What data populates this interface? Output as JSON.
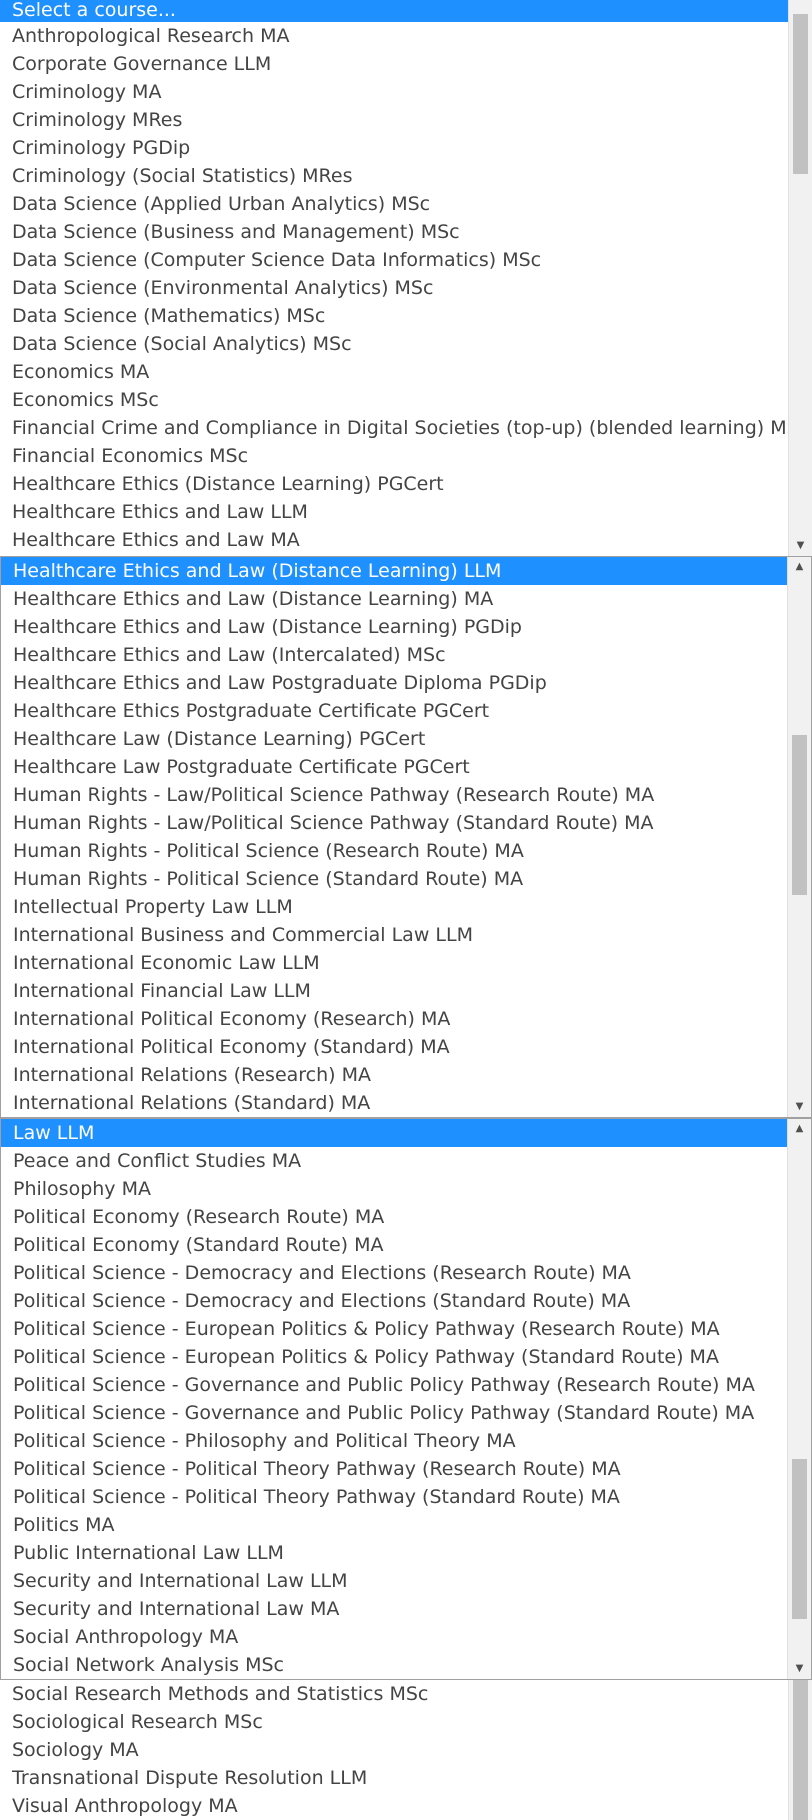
{
  "panel1": {
    "items": [
      {
        "label": "Select a course...",
        "selected": true
      },
      {
        "label": "Anthropological Research MA"
      },
      {
        "label": "Corporate Governance LLM"
      },
      {
        "label": "Criminology MA"
      },
      {
        "label": "Criminology MRes"
      },
      {
        "label": "Criminology PGDip"
      },
      {
        "label": "Criminology (Social Statistics) MRes"
      },
      {
        "label": "Data Science (Applied Urban Analytics) MSc"
      },
      {
        "label": "Data Science (Business and Management) MSc"
      },
      {
        "label": "Data Science (Computer Science Data Informatics) MSc"
      },
      {
        "label": "Data Science (Environmental Analytics) MSc"
      },
      {
        "label": "Data Science (Mathematics) MSc"
      },
      {
        "label": "Data Science (Social Analytics) MSc"
      },
      {
        "label": "Economics MA"
      },
      {
        "label": "Economics MSc"
      },
      {
        "label": "Financial Crime and Compliance in Digital Societies (top-up) (blended learning) MSc"
      },
      {
        "label": "Financial Economics MSc"
      },
      {
        "label": "Healthcare Ethics (Distance Learning) PGCert"
      },
      {
        "label": "Healthcare Ethics and Law LLM"
      },
      {
        "label": "Healthcare Ethics and Law MA"
      }
    ]
  },
  "panel2": {
    "items": [
      {
        "label": "Healthcare Ethics and Law (Distance Learning) LLM",
        "selected": true
      },
      {
        "label": "Healthcare Ethics and Law (Distance Learning) MA"
      },
      {
        "label": "Healthcare Ethics and Law (Distance Learning) PGDip"
      },
      {
        "label": "Healthcare Ethics and Law (Intercalated) MSc"
      },
      {
        "label": "Healthcare Ethics and Law Postgraduate Diploma PGDip"
      },
      {
        "label": "Healthcare Ethics Postgraduate Certificate PGCert"
      },
      {
        "label": "Healthcare Law (Distance Learning) PGCert"
      },
      {
        "label": "Healthcare Law Postgraduate Certificate PGCert"
      },
      {
        "label": "Human Rights - Law/Political Science Pathway (Research Route) MA"
      },
      {
        "label": "Human Rights - Law/Political Science Pathway (Standard Route) MA"
      },
      {
        "label": "Human Rights - Political Science (Research Route) MA"
      },
      {
        "label": "Human Rights - Political Science (Standard Route) MA"
      },
      {
        "label": "Intellectual Property Law LLM"
      },
      {
        "label": "International Business and Commercial Law LLM"
      },
      {
        "label": "International Economic Law LLM"
      },
      {
        "label": "International Financial Law LLM"
      },
      {
        "label": "International Political Economy (Research) MA"
      },
      {
        "label": "International Political Economy (Standard) MA"
      },
      {
        "label": "International Relations (Research) MA"
      },
      {
        "label": "International Relations (Standard) MA"
      }
    ]
  },
  "panel3": {
    "items": [
      {
        "label": "Law LLM",
        "selected": true
      },
      {
        "label": "Peace and Conflict Studies MA"
      },
      {
        "label": "Philosophy MA"
      },
      {
        "label": "Political Economy (Research Route) MA"
      },
      {
        "label": "Political Economy (Standard Route) MA"
      },
      {
        "label": "Political Science - Democracy and Elections (Research Route) MA"
      },
      {
        "label": "Political Science - Democracy and Elections (Standard Route) MA"
      },
      {
        "label": "Political Science - European Politics & Policy Pathway (Research Route) MA"
      },
      {
        "label": "Political Science - European Politics & Policy Pathway (Standard Route) MA"
      },
      {
        "label": "Political Science - Governance and Public Policy Pathway (Research Route) MA"
      },
      {
        "label": "Political Science - Governance and Public Policy Pathway (Standard Route) MA"
      },
      {
        "label": "Political Science - Philosophy and Political Theory MA"
      },
      {
        "label": "Political Science - Political Theory Pathway (Research Route) MA"
      },
      {
        "label": "Political Science - Political Theory Pathway (Standard Route) MA"
      },
      {
        "label": "Politics MA"
      },
      {
        "label": "Public International Law LLM"
      },
      {
        "label": "Security and International Law LLM"
      },
      {
        "label": "Security and International Law MA"
      },
      {
        "label": "Social Anthropology MA"
      },
      {
        "label": "Social Network Analysis MSc"
      }
    ]
  },
  "panel4": {
    "items": [
      {
        "label": "Social Research Methods and Statistics MSc"
      },
      {
        "label": "Sociological Research MSc"
      },
      {
        "label": "Sociology MA"
      },
      {
        "label": "Transnational Dispute Resolution LLM"
      },
      {
        "label": "Visual Anthropology MA"
      }
    ]
  },
  "icons": {
    "up": "scroll-up-arrow",
    "down": "scroll-down-arrow"
  }
}
